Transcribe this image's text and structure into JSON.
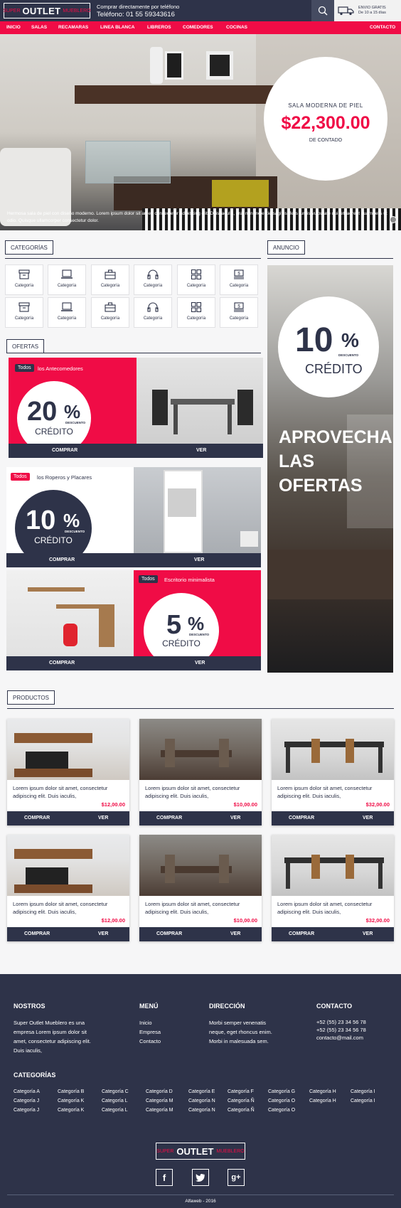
{
  "header": {
    "logo": {
      "pre": "SUPER",
      "main": "OUTLET",
      "post": "MUEBLERO"
    },
    "phone_label": "Comprar directamente por teléfono",
    "phone": "Teléfono: 01 55 59343616",
    "shipping_line1": "ENVIO GRATIS",
    "shipping_line2": "De 10 a 15 días"
  },
  "nav": {
    "items": [
      "INICIO",
      "SALAS",
      "RECAMARAS",
      "LINEA BLANCA",
      "LIBREROS",
      "COMEDORES",
      "COCINAS"
    ],
    "contact": "CONTACTO"
  },
  "hero": {
    "subtitle": "SALA MODERNA DE PIEL",
    "price": "$22,300.00",
    "note": "DE CONTADO",
    "caption": "Hermosa sala de piel con diseño moderno. Lorem ipsum dolor sit amet, consectetur adipiscing elit. Duis iaculis, erat non molestie sagittis, felis turpis vulputate dui, et laoreet quam felis ut odio. Quisque ullamcorper consectetur dolor."
  },
  "categories": {
    "title": "CATEGORÍAS",
    "item_label": "Categoría",
    "icons": [
      "box-icon",
      "laptop-icon",
      "briefcase-icon",
      "headphones-icon",
      "grid-icon",
      "money-icon"
    ]
  },
  "ad": {
    "title": "ANUNCIO",
    "percent": "10",
    "credit": "CRÉDITO",
    "discount": "DESCUENTO",
    "headline": [
      "APROVECHA",
      "LAS",
      "OFERTAS"
    ]
  },
  "offers": {
    "title": "OFERTAS",
    "tag": "Todos",
    "buy": "COMPRAR",
    "view": "VER",
    "discount": "DESCUENTO",
    "credit": "CRÉDITO",
    "items": [
      {
        "category": "los Antecomedores",
        "percent": "20"
      },
      {
        "category": "los Roperos y Placares",
        "percent": "10"
      },
      {
        "category": "Escritorio minimalista",
        "percent": "5"
      }
    ]
  },
  "products": {
    "title": "PRODUCTOS",
    "buy": "COMPRAR",
    "view": "VER",
    "items": [
      {
        "text": "Lorem ipsum dolor sit amet, consectetur adipiscing elit. Duis iaculis,",
        "price": "$12,00.00"
      },
      {
        "text": "Lorem ipsum dolor sit amet, consectetur adipiscing elit. Duis iaculis,",
        "price": "$10,00.00"
      },
      {
        "text": "Lorem ipsum dolor sit amet, consectetur adipiscing elit. Duis iaculis,",
        "price": "$32,00.00"
      },
      {
        "text": "Lorem ipsum dolor sit amet, consectetur adipiscing elit. Duis iaculis,",
        "price": "$12,00.00"
      },
      {
        "text": "Lorem ipsum dolor sit amet, consectetur adipiscing elit. Duis iaculis,",
        "price": "$10,00.00"
      },
      {
        "text": "Lorem ipsum dolor sit amet, consectetur adipiscing elit. Duis iaculis,",
        "price": "$32,00.00"
      }
    ]
  },
  "footer": {
    "about_title": "NOSTROS",
    "about_text": [
      "Super Outlet Mueblero es una",
      "empresa Lorem ipsum dolor sit",
      "amet, consectetur adipiscing elit.",
      "Duis iaculis,"
    ],
    "menu_title": "MENÚ",
    "menu": [
      "Inicio",
      "Empresa",
      "Contacto"
    ],
    "address_title": "DIRECCIÓN",
    "address": [
      "Morbi semper venenatis",
      "neque, eget rhoncus enim.",
      "Morbi in malesuada sem."
    ],
    "contact_title": "CONTACTO",
    "contact": [
      "+52 (55) 23 34 56 78",
      "+52 (55) 23 34 56 78",
      "contacto@mail.com"
    ],
    "categories_title": "CATEGORÍAS",
    "categories": [
      [
        "Categoría A",
        "Categoría B",
        "Categoría C",
        "Categoría D",
        "Categoría E",
        "Categoría F",
        "Categoría G",
        "Categoría H",
        "Categoría I"
      ],
      [
        "Categoría J",
        "Categoría K",
        "Categoría L",
        "Categoría M",
        "Categoría N",
        "Categoría Ñ",
        "Categoría O",
        "Categoría H",
        "Categoría I"
      ],
      [
        "Categoría J",
        "Categoría K",
        "Categoría L",
        "Categoría M",
        "Categoría N",
        "Categoría Ñ",
        "Categoría O"
      ]
    ],
    "social_icons": [
      "facebook-icon",
      "twitter-icon",
      "google-plus-icon"
    ],
    "copyright": "Alfaweb - 2016"
  },
  "colors": {
    "navy": "#2e3349",
    "pink": "#f00c46"
  }
}
